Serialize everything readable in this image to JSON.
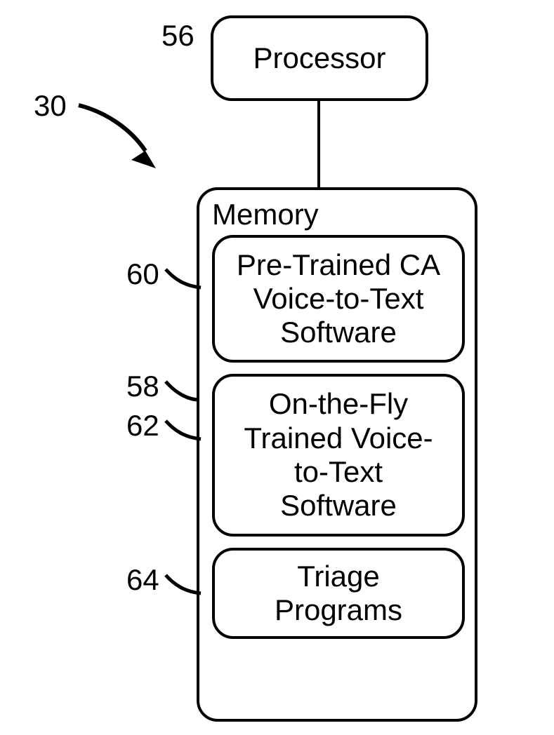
{
  "diagram": {
    "title_ref_30": "30",
    "processor": {
      "label": "Processor",
      "ref": "56"
    },
    "memory": {
      "title": "Memory",
      "ref": "58",
      "items": [
        {
          "ref": "60",
          "label": "Pre-Trained CA\nVoice-to-Text\nSoftware"
        },
        {
          "ref": "62",
          "label": "On-the-Fly\nTrained Voice-\nto-Text\nSoftware"
        },
        {
          "ref": "64",
          "label": "Triage\nPrograms"
        }
      ]
    }
  }
}
